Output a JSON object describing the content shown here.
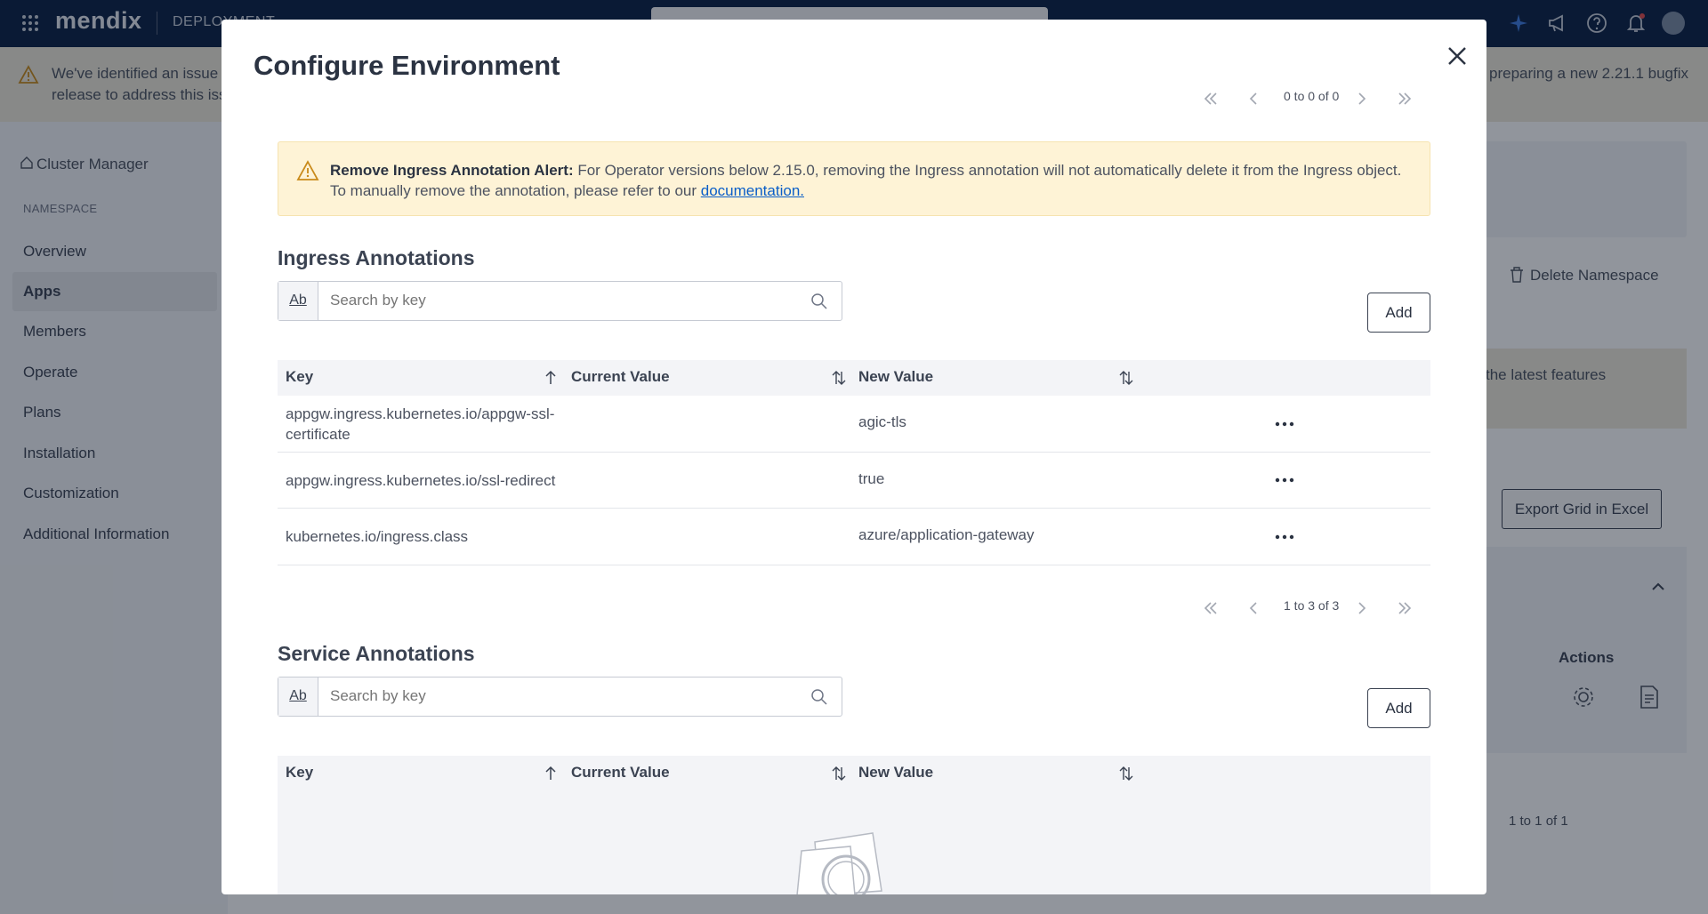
{
  "topbar": {
    "logo": "mendix",
    "product": "DEPLOYMENT",
    "icons": [
      "apps-grid-icon",
      "sparkle-icon",
      "megaphone-icon",
      "help-icon",
      "bell-icon",
      "avatar"
    ]
  },
  "banner": {
    "text_line1": "We've identified an issue v",
    "text_line2": "release to address this issu",
    "text_right": "preparing a new 2.21.1 bugfix"
  },
  "sidebar": {
    "cluster_link": "Cluster Manager",
    "section_label": "NAMESPACE",
    "items": [
      {
        "label": "Overview",
        "active": false
      },
      {
        "label": "Apps",
        "active": true
      },
      {
        "label": "Members",
        "active": false
      },
      {
        "label": "Operate",
        "active": false
      },
      {
        "label": "Plans",
        "active": false
      },
      {
        "label": "Installation",
        "active": false
      },
      {
        "label": "Customization",
        "active": false
      },
      {
        "label": "Additional Information",
        "active": false
      }
    ]
  },
  "background": {
    "delete_namespace": "Delete Namespace",
    "promo_text": "the latest features",
    "export_button": "Export Grid in Excel",
    "actions_header": "Actions",
    "pagination": "1 to 1 of 1"
  },
  "modal": {
    "title": "Configure Environment",
    "top_pagination": "0 to 0 of 0",
    "alert": {
      "title": "Remove Ingress Annotation Alert:",
      "body": " For Operator versions below 2.15.0, removing the Ingress annotation will not automatically delete it from the Ingress object. To manually remove the annotation, please refer to our ",
      "link": "documentation."
    },
    "ingress": {
      "title": "Ingress Annotations",
      "search_placeholder": "Search by key",
      "search_mode": "Ab",
      "add_label": "Add",
      "columns": {
        "key": "Key",
        "current": "Current Value",
        "new": "New Value"
      },
      "rows": [
        {
          "key": "appgw.ingress.kubernetes.io/appgw-ssl-certificate",
          "current": "",
          "new": "agic-tls"
        },
        {
          "key": "appgw.ingress.kubernetes.io/ssl-redirect",
          "current": "",
          "new": "true"
        },
        {
          "key": "kubernetes.io/ingress.class",
          "current": "",
          "new": "azure/application-gateway"
        }
      ],
      "pagination": "1 to 3 of 3"
    },
    "service": {
      "title": "Service Annotations",
      "search_placeholder": "Search by key",
      "search_mode": "Ab",
      "add_label": "Add",
      "columns": {
        "key": "Key",
        "current": "Current Value",
        "new": "New Value"
      }
    }
  },
  "colors": {
    "topbar": "#0a1f44",
    "alert_bg": "#fef3d6",
    "link": "#0a5ec8",
    "accent": "#3d7be0"
  }
}
